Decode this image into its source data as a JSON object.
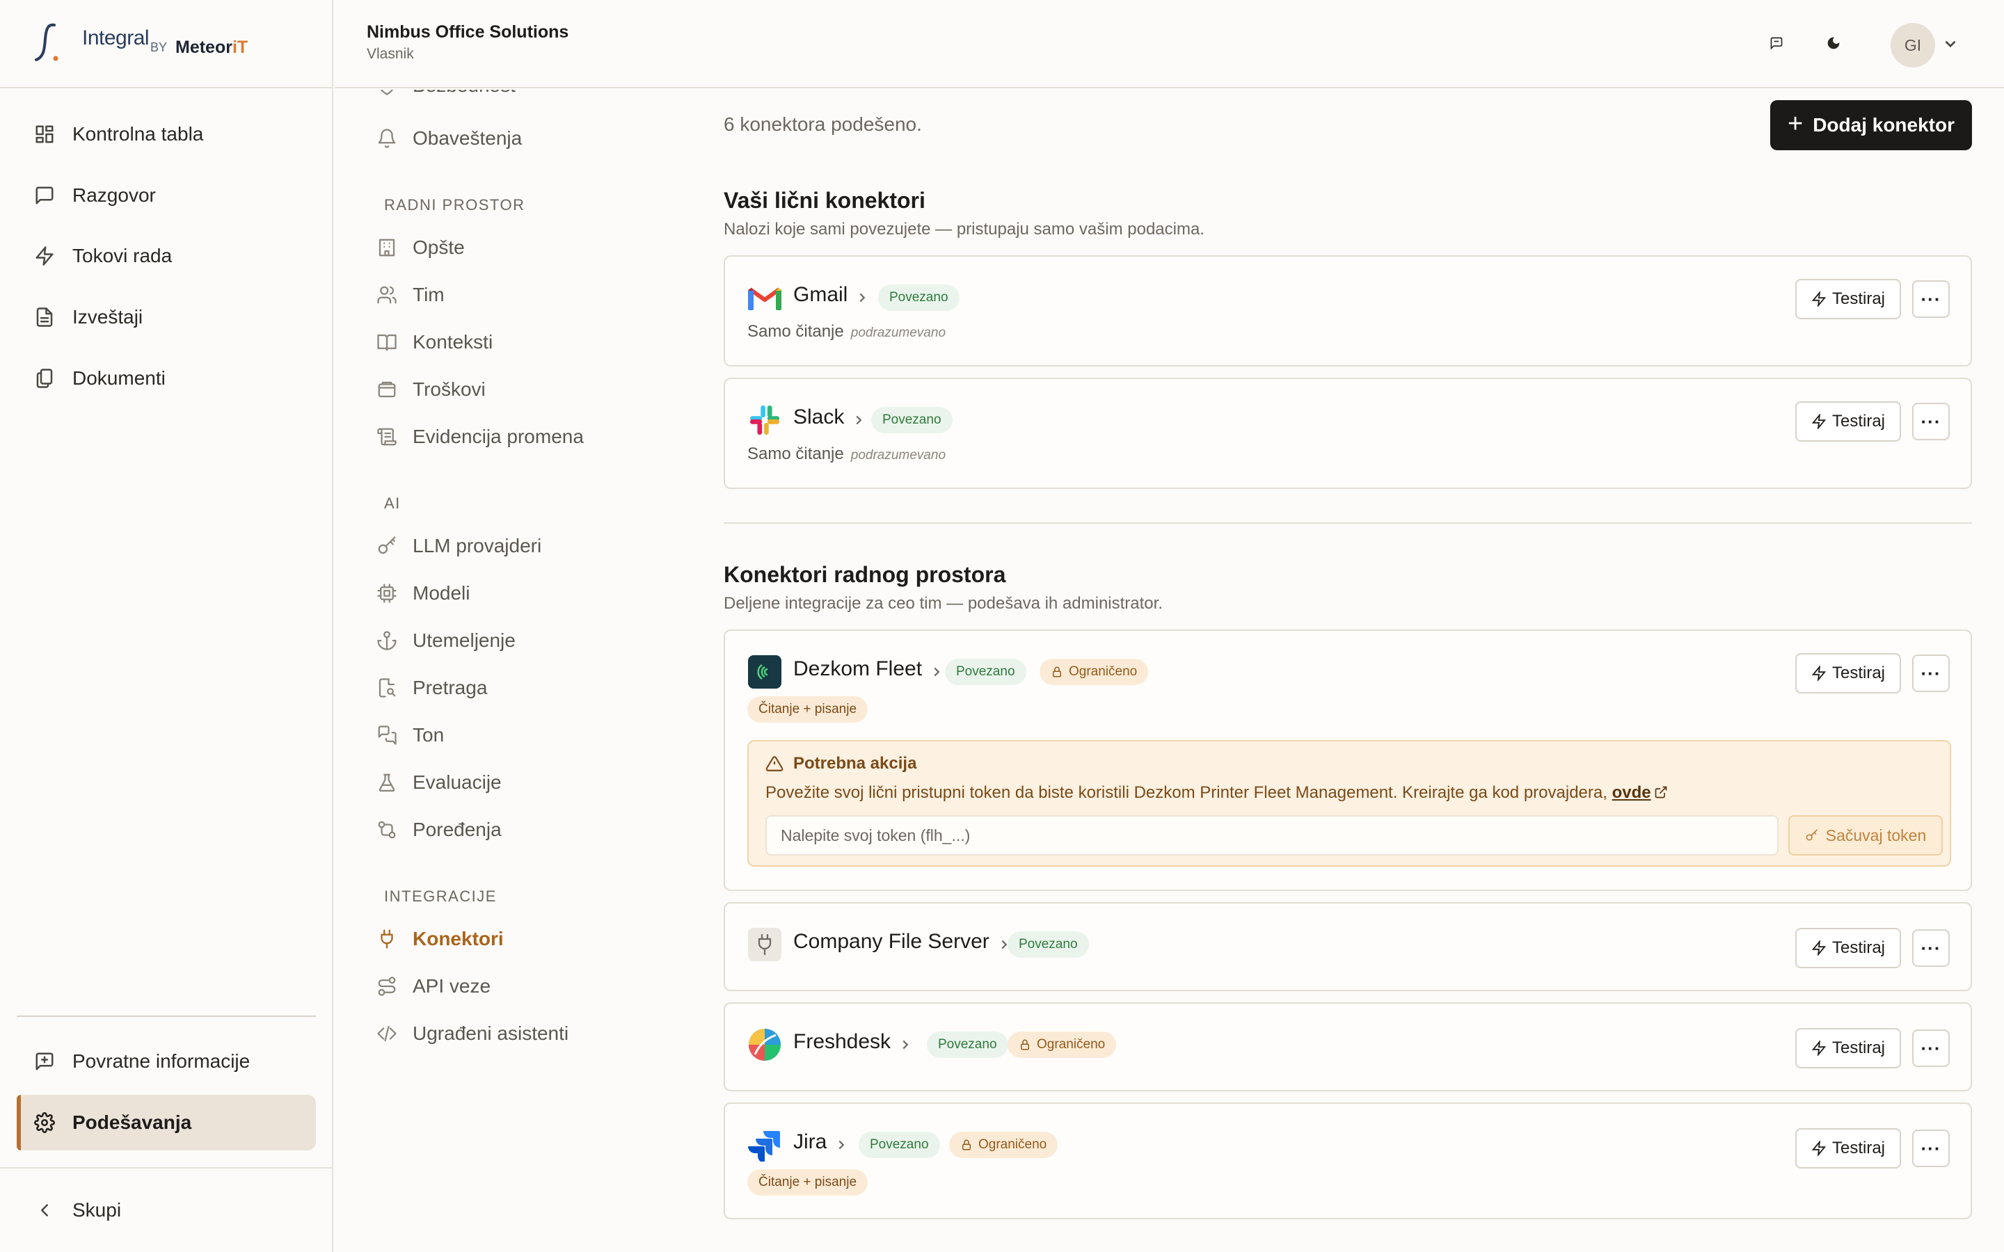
{
  "brand": {
    "name": "Integral",
    "by": "BY",
    "partner": "Meteor",
    "partner_suffix": "iT"
  },
  "header": {
    "org_name": "Nimbus Office Solutions",
    "org_role": "Vlasnik",
    "avatar_initials": "GI"
  },
  "sidebar": {
    "items": [
      {
        "label": "Kontrolna tabla",
        "icon": "dashboard-icon"
      },
      {
        "label": "Razgovor",
        "icon": "chat-icon"
      },
      {
        "label": "Tokovi rada",
        "icon": "bolt-icon"
      },
      {
        "label": "Izveštaji",
        "icon": "report-icon"
      },
      {
        "label": "Dokumenti",
        "icon": "documents-icon"
      }
    ],
    "feedback": "Povratne informacije",
    "settings": "Podešavanja",
    "collapse": "Skupi"
  },
  "settings_nav": {
    "partial_top": "Bezbednost",
    "notifications": "Obaveštenja",
    "section_workspace": "RADNI PROSTOR",
    "workspace_items": [
      "Opšte",
      "Tim",
      "Konteksti",
      "Troškovi",
      "Evidencija promena"
    ],
    "section_ai": "AI",
    "ai_items": [
      "LLM provajderi",
      "Modeli",
      "Utemeljenje",
      "Pretraga",
      "Ton",
      "Evaluacije",
      "Poređenja"
    ],
    "section_integrations": "INTEGRACIJE",
    "integration_items": [
      "Konektori",
      "API veze",
      "Ugrađeni asistenti"
    ]
  },
  "main": {
    "count_text": "6 konektora podešeno.",
    "add_button": "Dodaj konektor",
    "personal_title": "Vaši lični konektori",
    "personal_subtitle": "Nalozi koje sami povezujete — pristupaju samo vašim podacima.",
    "workspace_title": "Konektori radnog prostora",
    "workspace_subtitle": "Deljene integracije za ceo tim — podešava ih administrator.",
    "test_label": "Testiraj",
    "more_label": "···",
    "connected_label": "Povezano",
    "limited_label": "Ograničeno",
    "readonly_label": "Samo čitanje",
    "default_label": "podrazumevano",
    "readwrite_label": "Čitanje + pisanje",
    "connectors": [
      {
        "name": "Gmail"
      },
      {
        "name": "Slack"
      },
      {
        "name": "Dezkom Fleet"
      },
      {
        "name": "Company File Server"
      },
      {
        "name": "Freshdesk"
      },
      {
        "name": "Jira"
      }
    ],
    "alert": {
      "title": "Potrebna akcija",
      "text": "Povežite svoj lični pristupni token da biste koristili Dezkom Printer Fleet Management. Kreirajte ga kod provajdera, ",
      "link": "ovde",
      "input_placeholder": "Nalepite svoj token (flh_...)",
      "save_button": "Sačuvaj token"
    }
  },
  "colors": {
    "accent": "#b5702f",
    "primary_button": "#1c1a18",
    "connected_bg": "#eaf4ec",
    "limited_bg": "#fbebd6"
  }
}
